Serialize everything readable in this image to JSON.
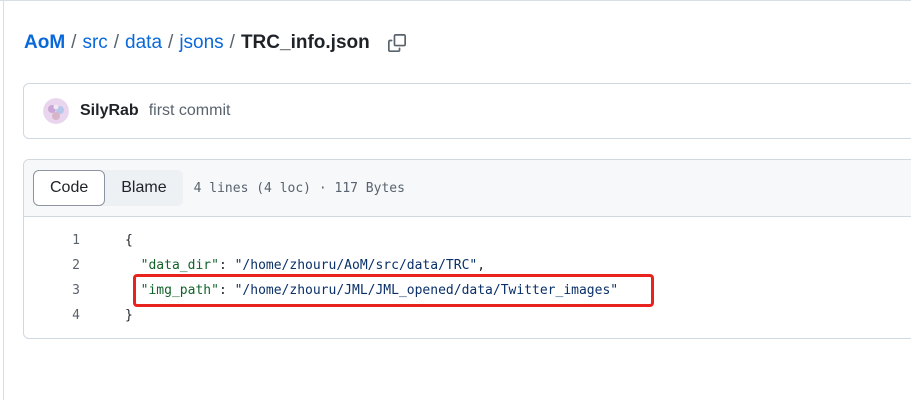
{
  "breadcrumb": {
    "repo": "AoM",
    "segments": [
      "src",
      "data",
      "jsons"
    ],
    "separator": "/",
    "file": "TRC_info.json",
    "copy_icon": "copy-icon"
  },
  "commit": {
    "author": "SilyRab",
    "message": "first commit"
  },
  "file_header": {
    "code_label": "Code",
    "blame_label": "Blame",
    "meta": "4 lines (4 loc) · 117 Bytes"
  },
  "code": {
    "lines": [
      {
        "num": "1",
        "parts": [
          {
            "t": "{",
            "c": "punc"
          }
        ]
      },
      {
        "num": "2",
        "parts": [
          {
            "t": "  ",
            "c": "punc"
          },
          {
            "t": "\"data_dir\"",
            "c": "key"
          },
          {
            "t": ": ",
            "c": "punc"
          },
          {
            "t": "\"/home/zhouru/AoM/src/data/TRC\"",
            "c": "str"
          },
          {
            "t": ",",
            "c": "punc"
          }
        ]
      },
      {
        "num": "3",
        "parts": [
          {
            "t": "  ",
            "c": "punc"
          },
          {
            "t": "\"img_path\"",
            "c": "key"
          },
          {
            "t": ": ",
            "c": "punc"
          },
          {
            "t": "\"/home/zhouru/JML/JML_opened/data/Twitter_images\"",
            "c": "str"
          }
        ]
      },
      {
        "num": "4",
        "parts": [
          {
            "t": "}",
            "c": "punc"
          }
        ]
      }
    ]
  },
  "colors": {
    "link": "#0969da",
    "highlight": "#e8231e",
    "json_key": "#116329",
    "json_string": "#0a3069"
  }
}
